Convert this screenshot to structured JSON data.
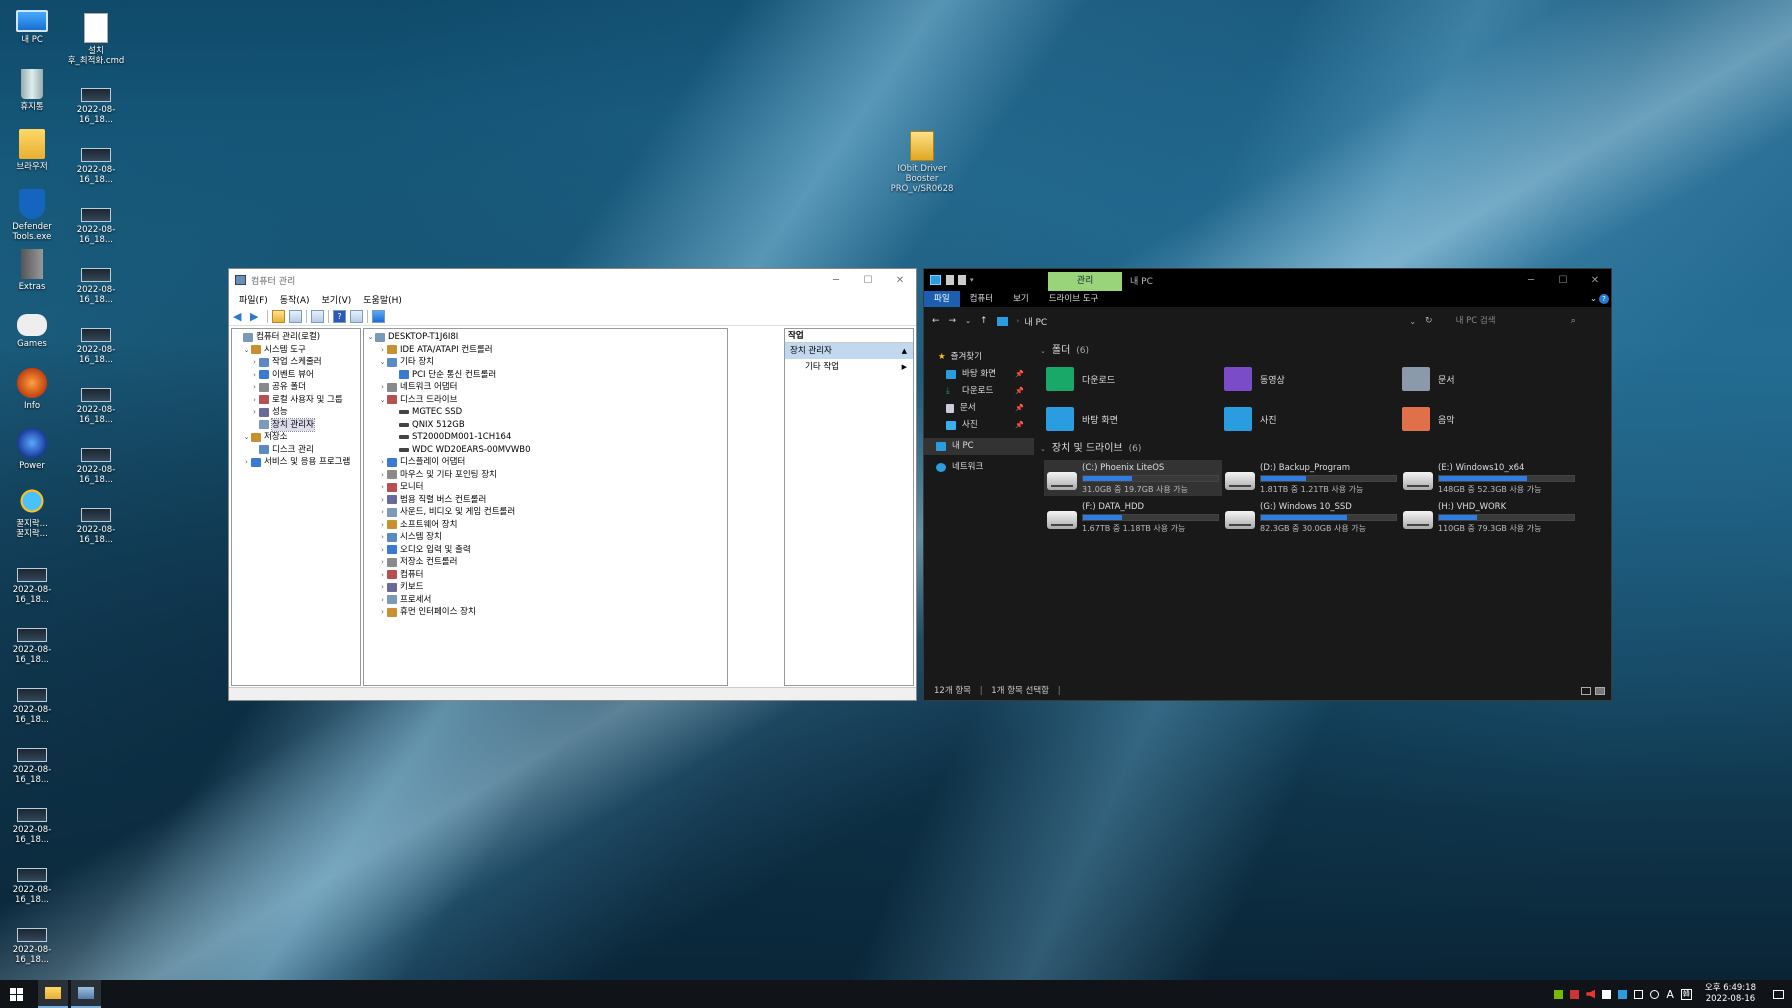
{
  "desktop": {
    "icons": [
      {
        "label": "내 PC"
      },
      {
        "label": "설치\n후_최적화.cmd"
      },
      {
        "label": "휴지통"
      },
      {
        "label": "2022-08-16_18..."
      },
      {
        "label": "브라우저"
      },
      {
        "label": "2022-08-16_18..."
      },
      {
        "label": "Defender\nTools.exe"
      },
      {
        "label": "2022-08-16_18..."
      },
      {
        "label": "Extras"
      },
      {
        "label": "2022-08-16_18..."
      },
      {
        "label": "Games"
      },
      {
        "label": "2022-08-16_18..."
      },
      {
        "label": "Info"
      },
      {
        "label": "2022-08-16_18..."
      },
      {
        "label": "Power"
      },
      {
        "label": "2022-08-16_18..."
      },
      {
        "label": "꿀지락...\n꿀지락..."
      },
      {
        "label": "2022-08-16_18..."
      },
      {
        "label": "2022-08-16_18..."
      },
      {
        "label": "2022-08-16_18..."
      },
      {
        "label": "2022-08-16_18..."
      },
      {
        "label": "2022-08-16_18..."
      },
      {
        "label": "2022-08-16_18..."
      },
      {
        "label": "2022-08-16_18..."
      },
      {
        "label": "2022-08-16_18..."
      },
      {
        "label": "IObit Driver\nBooster\nPRO_v/SR0628"
      }
    ]
  },
  "computer_management": {
    "title": "컴퓨터 관리",
    "menu": [
      "파일(F)",
      "동작(A)",
      "보기(V)",
      "도움말(H)"
    ],
    "left_tree": [
      {
        "label": "컴퓨터 관리(로컬)",
        "twisty": "",
        "level": 0
      },
      {
        "label": "시스템 도구",
        "twisty": "⌄",
        "level": 1
      },
      {
        "label": "작업 스케줄러",
        "twisty": "›",
        "level": 2
      },
      {
        "label": "이벤트 뷰어",
        "twisty": "›",
        "level": 2
      },
      {
        "label": "공유 폴더",
        "twisty": "›",
        "level": 2
      },
      {
        "label": "로컬 사용자 및 그룹",
        "twisty": "›",
        "level": 2
      },
      {
        "label": "성능",
        "twisty": "›",
        "level": 2
      },
      {
        "label": "장치 관리자",
        "twisty": "",
        "level": 2,
        "selected": true
      },
      {
        "label": "저장소",
        "twisty": "⌄",
        "level": 1
      },
      {
        "label": "디스크 관리",
        "twisty": "",
        "level": 2
      },
      {
        "label": "서비스 및 응용 프로그램",
        "twisty": "›",
        "level": 1
      }
    ],
    "device_tree": [
      {
        "label": "DESKTOP-T1J6I8I",
        "twisty": "⌄",
        "level": 0
      },
      {
        "label": "IDE ATA/ATAPI 컨트롤러",
        "twisty": "›",
        "level": 1
      },
      {
        "label": "기타 장치",
        "twisty": "⌄",
        "level": 1
      },
      {
        "label": "PCI 단순 통신 컨트롤러",
        "twisty": "",
        "level": 2
      },
      {
        "label": "네트워크 어댑터",
        "twisty": "›",
        "level": 1
      },
      {
        "label": "디스크 드라이브",
        "twisty": "⌄",
        "level": 1
      },
      {
        "label": "MGTEC SSD",
        "twisty": "",
        "level": 2
      },
      {
        "label": "QNIX 512GB",
        "twisty": "",
        "level": 2
      },
      {
        "label": "ST2000DM001-1CH164",
        "twisty": "",
        "level": 2
      },
      {
        "label": "WDC WD20EARS-00MVWB0",
        "twisty": "",
        "level": 2
      },
      {
        "label": "디스플레이 어댑터",
        "twisty": "›",
        "level": 1
      },
      {
        "label": "마우스 및 기타 포인팅 장치",
        "twisty": "›",
        "level": 1
      },
      {
        "label": "모니터",
        "twisty": "›",
        "level": 1
      },
      {
        "label": "범용 직렬 버스 컨트롤러",
        "twisty": "›",
        "level": 1
      },
      {
        "label": "사운드, 비디오 및 게임 컨트롤러",
        "twisty": "›",
        "level": 1
      },
      {
        "label": "소프트웨어 장치",
        "twisty": "›",
        "level": 1
      },
      {
        "label": "시스템 장치",
        "twisty": "›",
        "level": 1
      },
      {
        "label": "오디오 입력 및 출력",
        "twisty": "›",
        "level": 1
      },
      {
        "label": "저장소 컨트롤러",
        "twisty": "›",
        "level": 1
      },
      {
        "label": "컴퓨터",
        "twisty": "›",
        "level": 1
      },
      {
        "label": "키보드",
        "twisty": "›",
        "level": 1
      },
      {
        "label": "프로세서",
        "twisty": "›",
        "level": 1
      },
      {
        "label": "휴먼 인터페이스 장치",
        "twisty": "›",
        "level": 1
      }
    ],
    "actions": {
      "header": "작업",
      "selected": "장치 관리자",
      "item": "기타 작업"
    }
  },
  "explorer": {
    "manage_tab": "관리",
    "title": "내 PC",
    "ribbon_tabs": [
      "파일",
      "컴퓨터",
      "보기",
      "드라이브 도구"
    ],
    "address": "내 PC",
    "search_placeholder": "내 PC 검색",
    "nav": {
      "quick_access": "즐겨찾기",
      "items": [
        "바탕 화면",
        "다운로드",
        "문서",
        "사진"
      ],
      "this_pc": "내 PC",
      "network": "네트워크"
    },
    "folders_header": "폴더",
    "folders_count": "(6)",
    "folders": [
      {
        "name": "다운로드",
        "color": "#18a868"
      },
      {
        "name": "동영상",
        "color": "#7a4cc8"
      },
      {
        "name": "문서",
        "color": "#8a9aab"
      },
      {
        "name": "바탕 화면",
        "color": "#2a9de0"
      },
      {
        "name": "사진",
        "color": "#2a9de0"
      },
      {
        "name": "음악",
        "color": "#e0704a"
      }
    ],
    "drives_header": "장치 및 드라이브",
    "drives_count": "(6)",
    "drives": [
      {
        "name": "(C:) Phoenix LiteOS",
        "detail": "31.0GB 중 19.7GB 사용 가능",
        "used": 0.36,
        "selected": true
      },
      {
        "name": "(D:) Backup_Program",
        "detail": "1.81TB 중 1.21TB 사용 가능",
        "used": 0.33,
        "selected": false
      },
      {
        "name": "(E:) Windows10_x64",
        "detail": "148GB 중 52.3GB 사용 가능",
        "used": 0.65,
        "selected": false
      },
      {
        "name": "(F:) DATA_HDD",
        "detail": "1.67TB 중 1.18TB 사용 가능",
        "used": 0.29,
        "selected": false
      },
      {
        "name": "(G:) Windows 10_SSD",
        "detail": "82.3GB 중 30.0GB 사용 가능",
        "used": 0.64,
        "selected": false
      },
      {
        "name": "(H:) VHD_WORK",
        "detail": "110GB 중 79.3GB 사용 가능",
        "used": 0.28,
        "selected": false
      }
    ],
    "status_items": "12개 항목",
    "status_selected": "1개 항목 선택함"
  },
  "taskbar": {
    "tray_lang": "A",
    "ime": "韓",
    "time": "오후 6:49:18",
    "date": "2022-08-16"
  }
}
